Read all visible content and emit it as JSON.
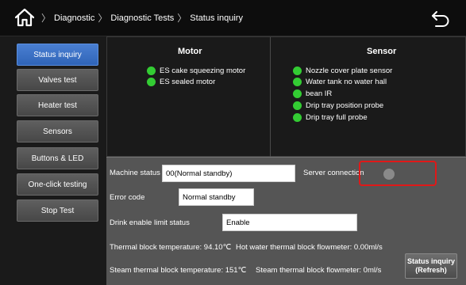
{
  "header": {
    "breadcrumbs": [
      "Diagnostic",
      "Diagnostic Tests",
      "Status inquiry"
    ],
    "home_icon": "home-icon",
    "back_icon": "back-arrow-icon"
  },
  "sidebar": {
    "items": [
      {
        "label": "Status inquiry",
        "active": true
      },
      {
        "label": "Valves test",
        "active": false
      },
      {
        "label": "Heater test",
        "active": false
      },
      {
        "label": "Sensors",
        "active": false
      },
      {
        "label": "Buttons & LED",
        "active": false
      },
      {
        "label": "One-click testing",
        "active": false
      },
      {
        "label": "Stop Test",
        "active": false
      }
    ]
  },
  "motor": {
    "title": "Motor",
    "items": [
      "ES cake squeezing motor",
      "ES sealed motor"
    ]
  },
  "sensor": {
    "title": "Sensor",
    "items": [
      "Nozzle cover plate sensor",
      "Water tank no water hall",
      "bean IR",
      "Drip tray position probe",
      "Drip tray full probe"
    ]
  },
  "status": {
    "machine_status_label": "Machine status",
    "machine_status_value": "00(Normal standby)",
    "server_connection_label": "Server connection",
    "error_code_label": "Error code",
    "error_code_value": "Normal standby",
    "drink_limit_label": "Drink enable limit status",
    "drink_limit_value": "Enable",
    "thermal_block_temp": "Thermal block temperature:  94.10℃",
    "hot_water_flow": "Hot water thermal block flowmeter:  0.00ml/s",
    "steam_block_temp": "Steam thermal block temperature:   151℃",
    "steam_flow": "Steam thermal block flowmeter:  0ml/s",
    "refresh_line1": "Status inquiry",
    "refresh_line2": "(Refresh)"
  },
  "colors": {
    "indicator_on": "#33cc33",
    "indicator_off": "#8a8a8a",
    "active_tab": "#3b6fc4",
    "highlight": "#e01818"
  }
}
